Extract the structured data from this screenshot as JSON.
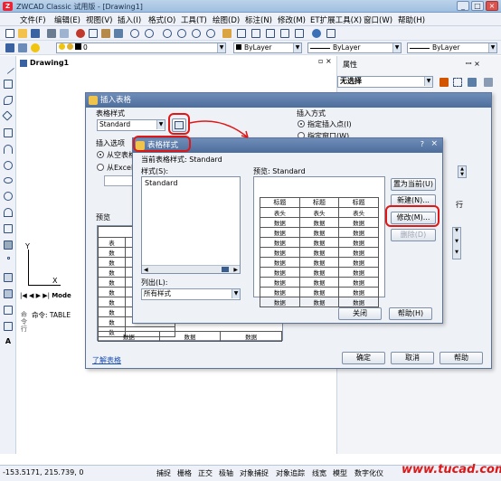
{
  "app": {
    "title": "ZWCAD Classic 试用版 - [Drawing1]",
    "icon": "Z",
    "window_buttons": [
      "_",
      "□",
      "×"
    ]
  },
  "menu": [
    "文件(F)",
    "编辑(E)",
    "视图(V)",
    "插入(I)",
    "格式(O)",
    "工具(T)",
    "绘图(D)",
    "标注(N)",
    "修改(M)",
    "ET扩展工具(X)",
    "窗口(W)",
    "帮助(H)"
  ],
  "layer_combo": "0",
  "color_combo": "ByLayer",
  "linetype_combo": "ByLayer",
  "lineweight_combo": "ByLayer",
  "drawing_tab": "Drawing1",
  "layout_tabs": [
    "Mode"
  ],
  "axis_labels": {
    "x": "X",
    "y": "Y"
  },
  "command_line": "命令: TABLE",
  "status": {
    "coords": "-153.5171, 215.739, 0",
    "buttons": [
      "捕捉",
      "栅格",
      "正交",
      "极轴",
      "对象捕捉",
      "对象追踪",
      "线宽",
      "模型",
      "数字化仪"
    ]
  },
  "properties": {
    "title": "属性",
    "selection": "无选择"
  },
  "insert_dialog": {
    "title": "插入表格",
    "style_label": "表格样式",
    "style_value": "Standard",
    "insert_options_label": "插入选项",
    "opt_empty": "从空表格",
    "opt_excel": "从Excel导",
    "preview_label": "预览",
    "insert_method_label": "插入方式",
    "method_point": "指定插入点(I)",
    "method_window": "指定窗口(W)",
    "rows_suffix": "行",
    "preview_header": "标",
    "preview_cells": [
      "表",
      "数",
      "数",
      "数",
      "数",
      "数",
      "数",
      "数",
      "数",
      "数"
    ],
    "preview_bottom": [
      "数据",
      "数据",
      "数据"
    ],
    "link": "了解表格",
    "ok": "确定",
    "cancel": "取消",
    "help": "帮助"
  },
  "style_dialog": {
    "title": "表格样式",
    "current_label": "当前表格样式:",
    "current_value": "Standard",
    "styles_label": "样式(S):",
    "styles": [
      "Standard"
    ],
    "preview_label": "预览:",
    "preview_value": "Standard",
    "list_label": "列出(L):",
    "list_value": "所有样式",
    "set_current": "置为当前(U)",
    "new": "新建(N)...",
    "modify": "修改(M)...",
    "delete": "删除(D)",
    "close": "关闭",
    "help": "帮助(H)",
    "question": "?",
    "close_x": "×",
    "table_title": "标题",
    "table_header": "表头",
    "table_data": "数据"
  },
  "watermark": "www.tucad.com",
  "accent_red": "#e01717"
}
